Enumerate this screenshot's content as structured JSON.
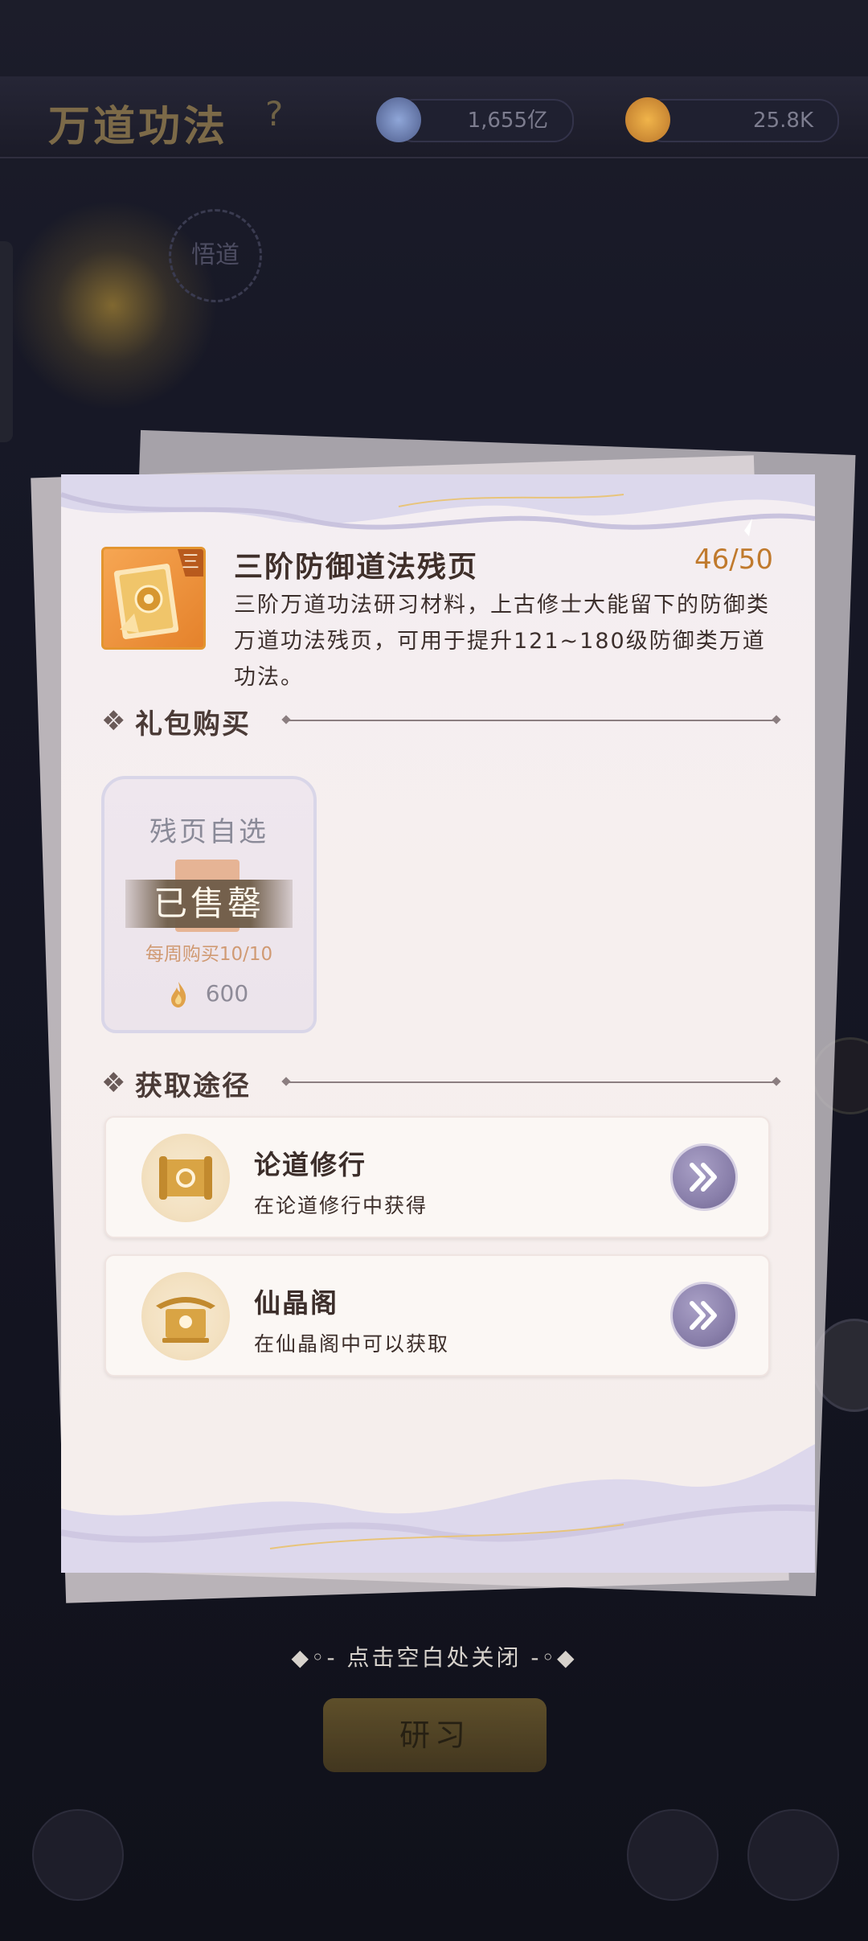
{
  "topbar": {
    "title": "万道功法",
    "help": "?",
    "res1_value": "1,655亿",
    "res2_value": "25.8K"
  },
  "deco": {
    "label": "悟道"
  },
  "item": {
    "tier": "三",
    "name": "三阶防御道法残页",
    "count": "46/50",
    "description": "三阶万道功法研习材料，上古修士大能留下的防御类万道功法残页，可用于提升121~180级防御类万道功法。"
  },
  "sections": {
    "gift_title": "礼包购买",
    "source_title": "获取途径",
    "bullet": "❖"
  },
  "gift": {
    "title": "残页自选",
    "status": "已售罄",
    "weekly": "每周购买10/10",
    "price": "600"
  },
  "sources": [
    {
      "title": "论道修行",
      "desc": "在论道修行中获得",
      "icon": "scroll-icon"
    },
    {
      "title": "仙晶阁",
      "desc": "在仙晶阁中可以获取",
      "icon": "pavilion-icon"
    }
  ],
  "footer": {
    "close_tip": "◆◦- 点击空白处关闭 -◦◆",
    "study_button": "研习"
  },
  "colors": {
    "count": "#c07a2d",
    "icon_orange": "#e5822b",
    "go_button": "#8a80ab",
    "soldout_band": "#6e5c48"
  }
}
